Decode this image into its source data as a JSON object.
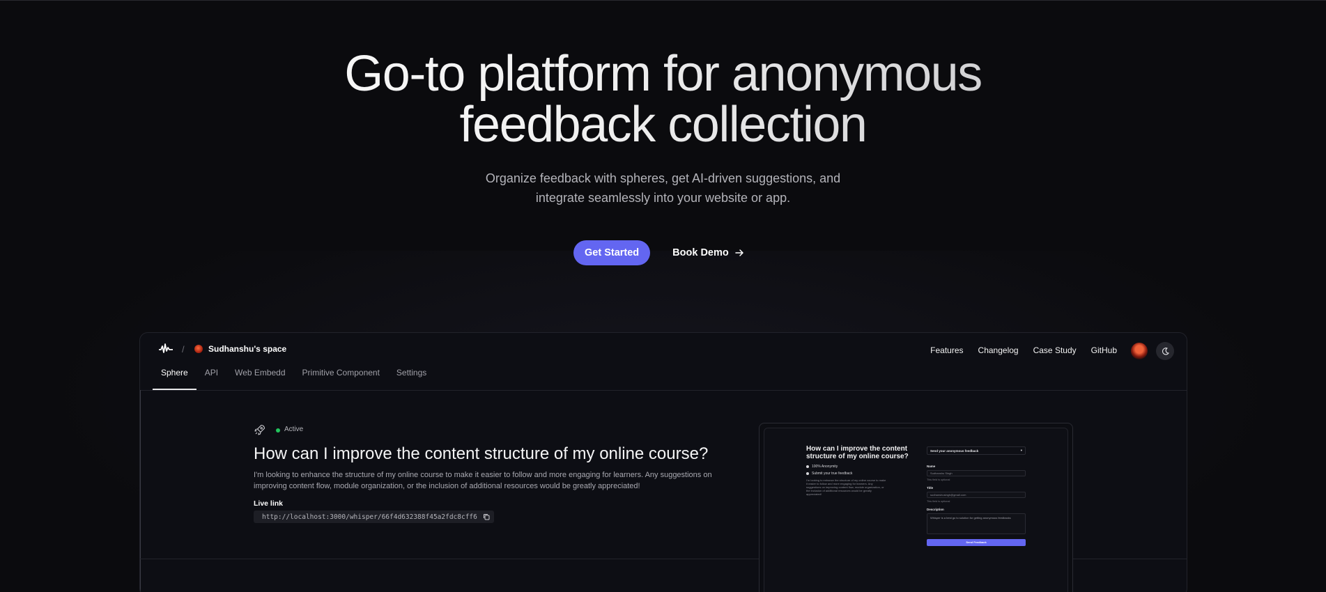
{
  "hero": {
    "title_line1": "Go-to platform for anonymous",
    "title_line2": "feedback collection",
    "subtitle_line1": "Organize feedback with spheres, get AI-driven suggestions, and",
    "subtitle_line2": "integrate seamlessly into your website or app.",
    "primary_cta": "Get Started",
    "secondary_cta": "Book Demo",
    "secondary_icon": "arrow-right-icon"
  },
  "preview": {
    "breadcrumb_separator": "/",
    "space_name": "Sudhanshu's space",
    "nav": [
      "Features",
      "Changelog",
      "Case Study",
      "GitHub"
    ],
    "tabs": [
      "Sphere",
      "API",
      "Web Embedd",
      "Primitive Component",
      "Settings"
    ],
    "active_tab": "Sphere",
    "sphere": {
      "status": "Active",
      "title": "How can I improve the content structure of my online course?",
      "description": "I'm looking to enhance the structure of my online course to make it easier to follow and more engaging for learners. Any suggestions on improving content flow, module organization, or the inclusion of additional resources would be greatly appreciated!",
      "live_link_label": "Live link",
      "live_link": "http://localhost:3000/whisper/66f4d632388f45a2fdc8cff6"
    },
    "embed": {
      "title": "How can I improve the content structure of my online course?",
      "checks": [
        "100% Anonymity",
        "Submit your true feedback"
      ],
      "description": "I'm looking to enhance the structure of my online course to make it easier to follow and more engaging for learners. Any suggestions on improving content flow, module organization, or the inclusion of additional resources would be greatly appreciated!",
      "select_label": "Send your anonymous feedback",
      "name_label": "Name",
      "name_value": "Sudhanshu Singh",
      "name_hint": "This field is optional",
      "title_label": "Title",
      "title_value": "sudhanshusingh@gmail.com",
      "title_hint": "This field is optional",
      "description_label": "Description",
      "description_value": "Whisper is a best go to solution for getting anonymous feedbacks",
      "submit": "Send Feedback"
    }
  },
  "colors": {
    "background": "#0b0b0e",
    "accent": "#6366f1",
    "status_active": "#22c55e"
  }
}
